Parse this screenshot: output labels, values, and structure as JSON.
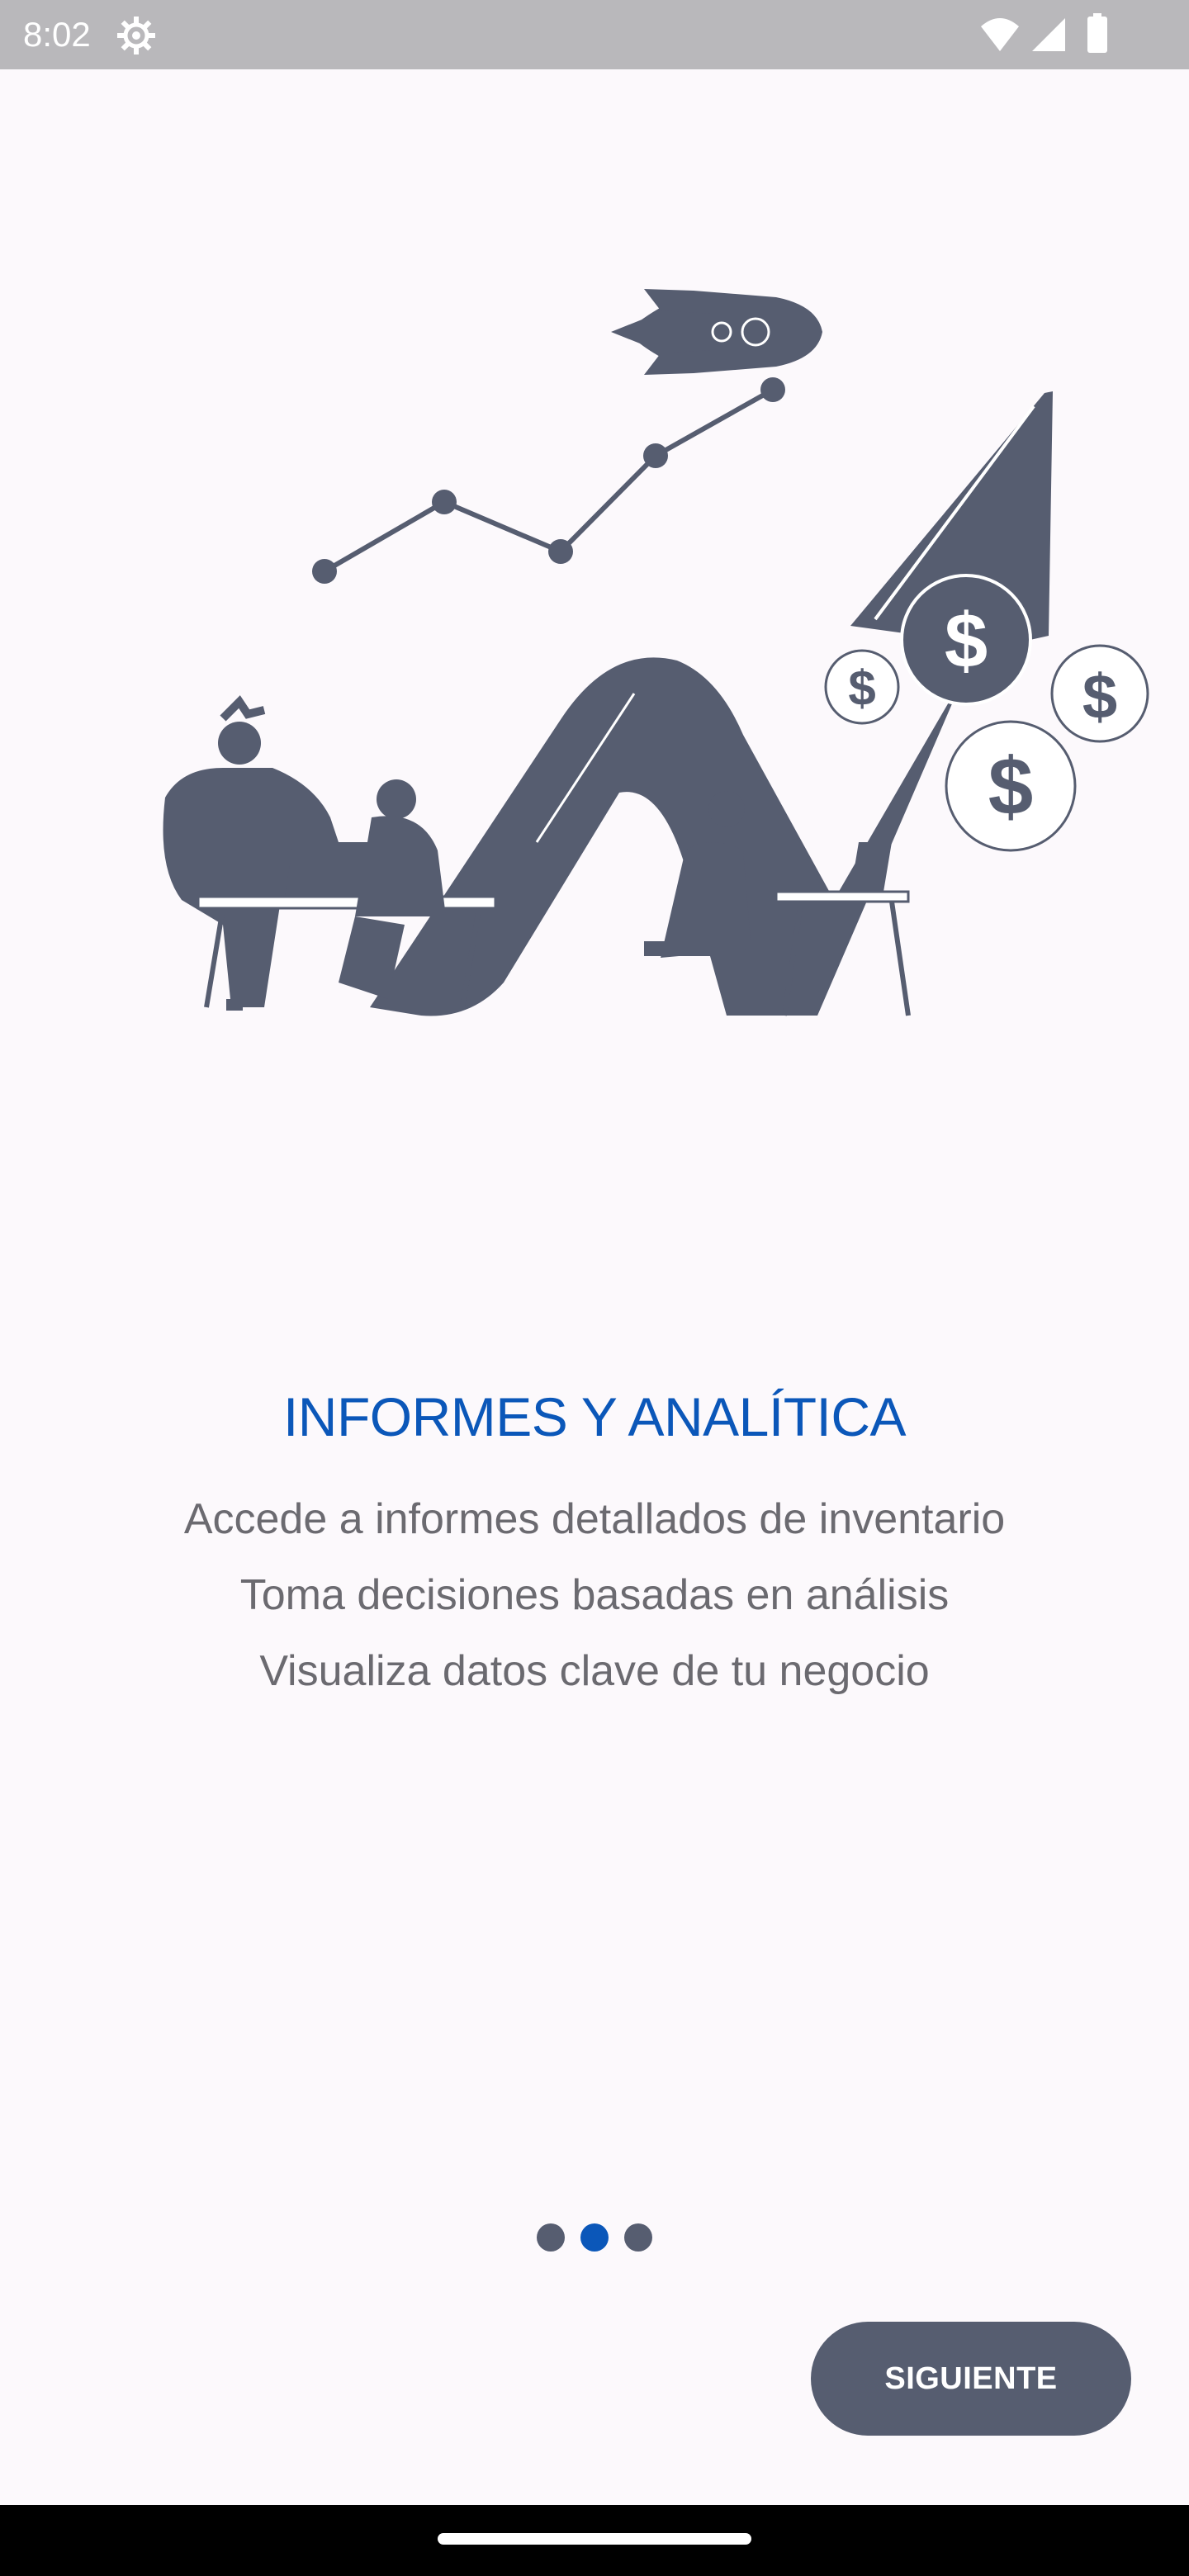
{
  "status_bar": {
    "time": "8:02",
    "icons": [
      "settings-icon",
      "wifi-icon",
      "signal-icon",
      "battery-icon"
    ]
  },
  "illustration": {
    "description_icon": "growth-chart-illustration-icon",
    "currency_symbol": "$"
  },
  "onboarding": {
    "title": "INFORMES Y ANALÍTICA",
    "lines": [
      "Accede a informes detallados de inventario",
      "Toma decisiones basadas en análisis",
      "Visualiza datos clave de tu negocio"
    ],
    "current_page": 2,
    "total_pages": 3
  },
  "actions": {
    "next_label": "SIGUIENTE"
  },
  "colors": {
    "accent": "#0b57b9",
    "primary_dark": "#565d70",
    "background": "#fcf9fc",
    "text_secondary": "#6b6a70"
  }
}
